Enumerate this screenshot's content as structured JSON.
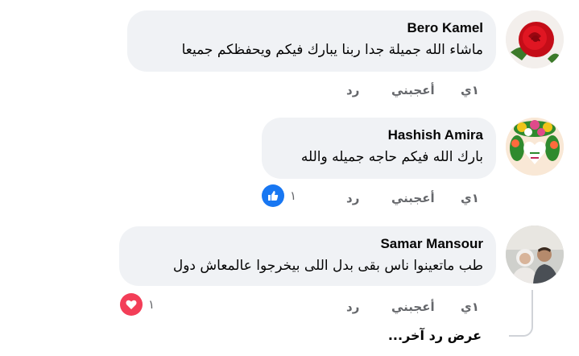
{
  "comments": [
    {
      "author": "Bero Kamel",
      "text": "ماشاء الله جميلة جدا ربنا يبارك فيكم ويحفظكم جميعا",
      "time": "١ي",
      "like_label": "أعجبني",
      "reply_label": "رد",
      "avatar_icon": "red-rose-avatar"
    },
    {
      "author": "Hashish Amira",
      "text": "بارك الله فيكم حاجه جميله والله",
      "time": "١ي",
      "like_label": "أعجبني",
      "reply_label": "رد",
      "reaction_icon": "like-reaction-icon",
      "reaction_color": "#1877f2",
      "reaction_count": "١",
      "avatar_icon": "flower-wreath-avatar"
    },
    {
      "author": "Samar Mansour",
      "text": "طب ماتعينوا ناس بقى بدل اللى بيخرجوا عالمعاش دول",
      "time": "١ي",
      "like_label": "أعجبني",
      "reply_label": "رد",
      "reaction_icon": "love-reaction-icon",
      "reaction_color": "#f33e58",
      "reaction_count": "١",
      "avatar_icon": "couple-photo-avatar"
    }
  ],
  "view_more_replies": "عرض رد آخر..."
}
